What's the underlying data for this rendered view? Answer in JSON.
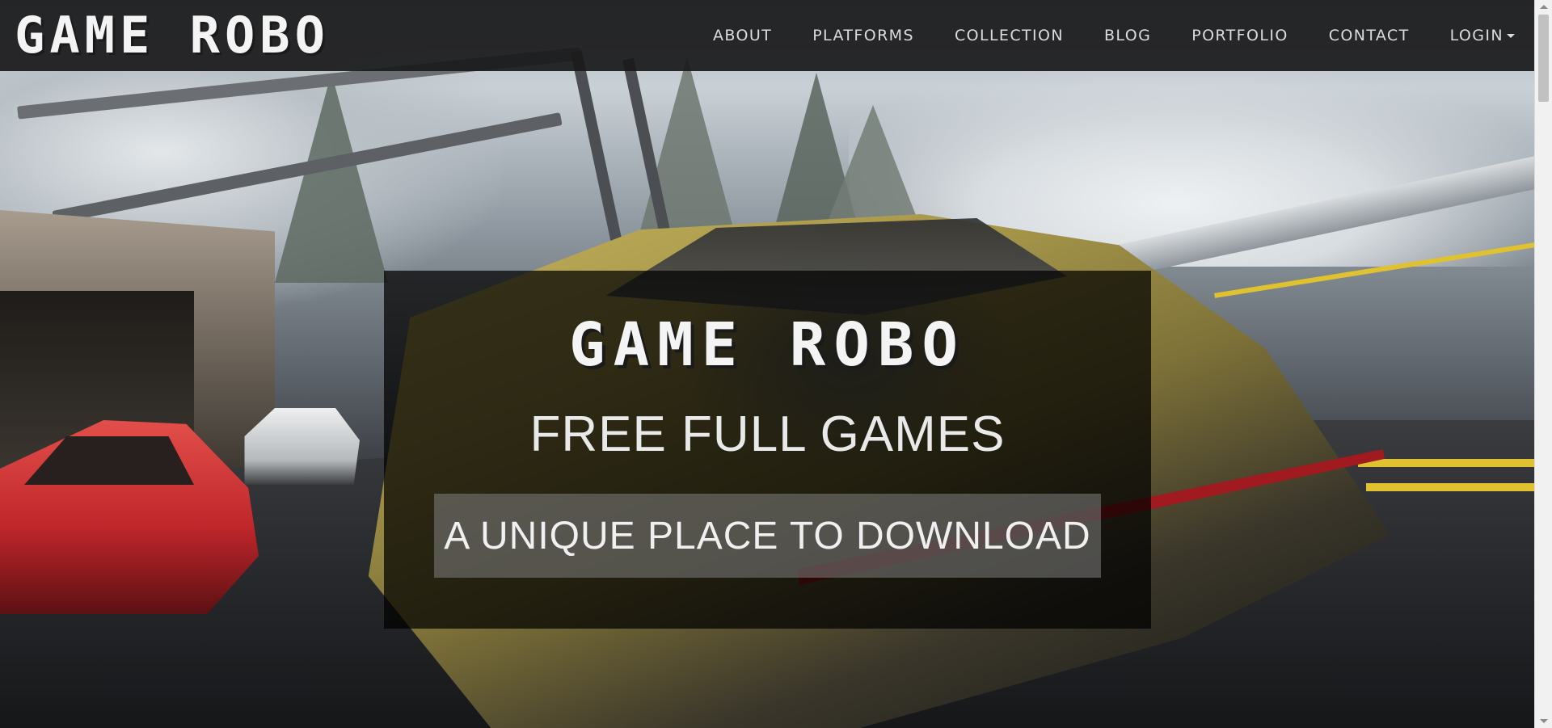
{
  "navbar": {
    "brand": "GAME ROBO",
    "links": [
      "ABOUT",
      "PLATFORMS",
      "COLLECTION",
      "BLOG",
      "PORTFOLIO",
      "CONTACT",
      "LOGIN"
    ]
  },
  "hero": {
    "title": "GAME ROBO",
    "subtitle": "FREE FULL GAMES",
    "cta_label": "A UNIQUE PLACE TO DOWNLOAD",
    "background_icon": "racing-cars-scene"
  },
  "colors": {
    "navbar_bg": "#19191a",
    "panel_bg": "#000000",
    "cta_bg": "#808080",
    "text": "#f4f4f4"
  }
}
